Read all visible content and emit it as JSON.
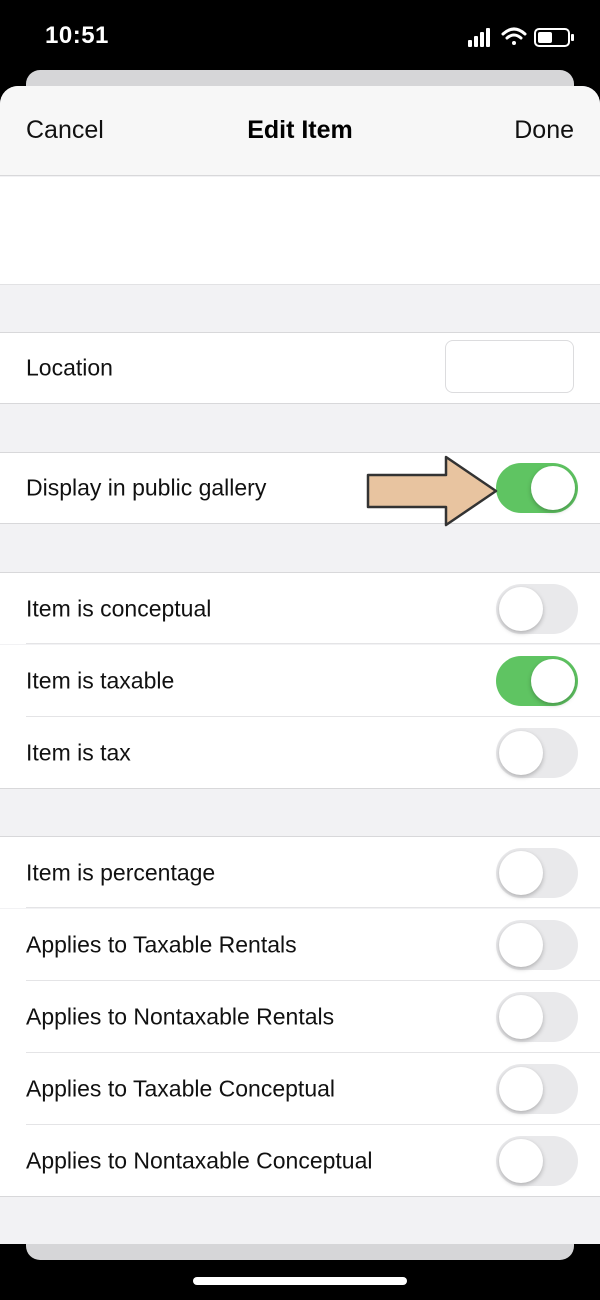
{
  "status_bar": {
    "time": "10:51",
    "icons": [
      "signal-icon",
      "wifi-icon",
      "battery-icon"
    ]
  },
  "nav": {
    "cancel_label": "Cancel",
    "title": "Edit Item",
    "done_label": "Done"
  },
  "location": {
    "label": "Location",
    "value": "",
    "placeholder": ""
  },
  "public_gallery": {
    "label": "Display in public gallery",
    "on": true
  },
  "group1": [
    {
      "label": "Item is conceptual",
      "on": false
    },
    {
      "label": "Item is taxable",
      "on": true
    },
    {
      "label": "Item is tax",
      "on": false
    }
  ],
  "group2": [
    {
      "label": "Item is percentage",
      "on": false
    },
    {
      "label": "Applies to Taxable Rentals",
      "on": false
    },
    {
      "label": "Applies to Nontaxable Rentals",
      "on": false
    },
    {
      "label": "Applies to Taxable Conceptual",
      "on": false
    },
    {
      "label": "Applies to Nontaxable Conceptual",
      "on": false
    }
  ],
  "colors": {
    "toggle_on": "#5fc462",
    "toggle_off": "#e9e9eb",
    "arrow_fill": "#e8c4a0",
    "background": "#f2f2f4"
  }
}
